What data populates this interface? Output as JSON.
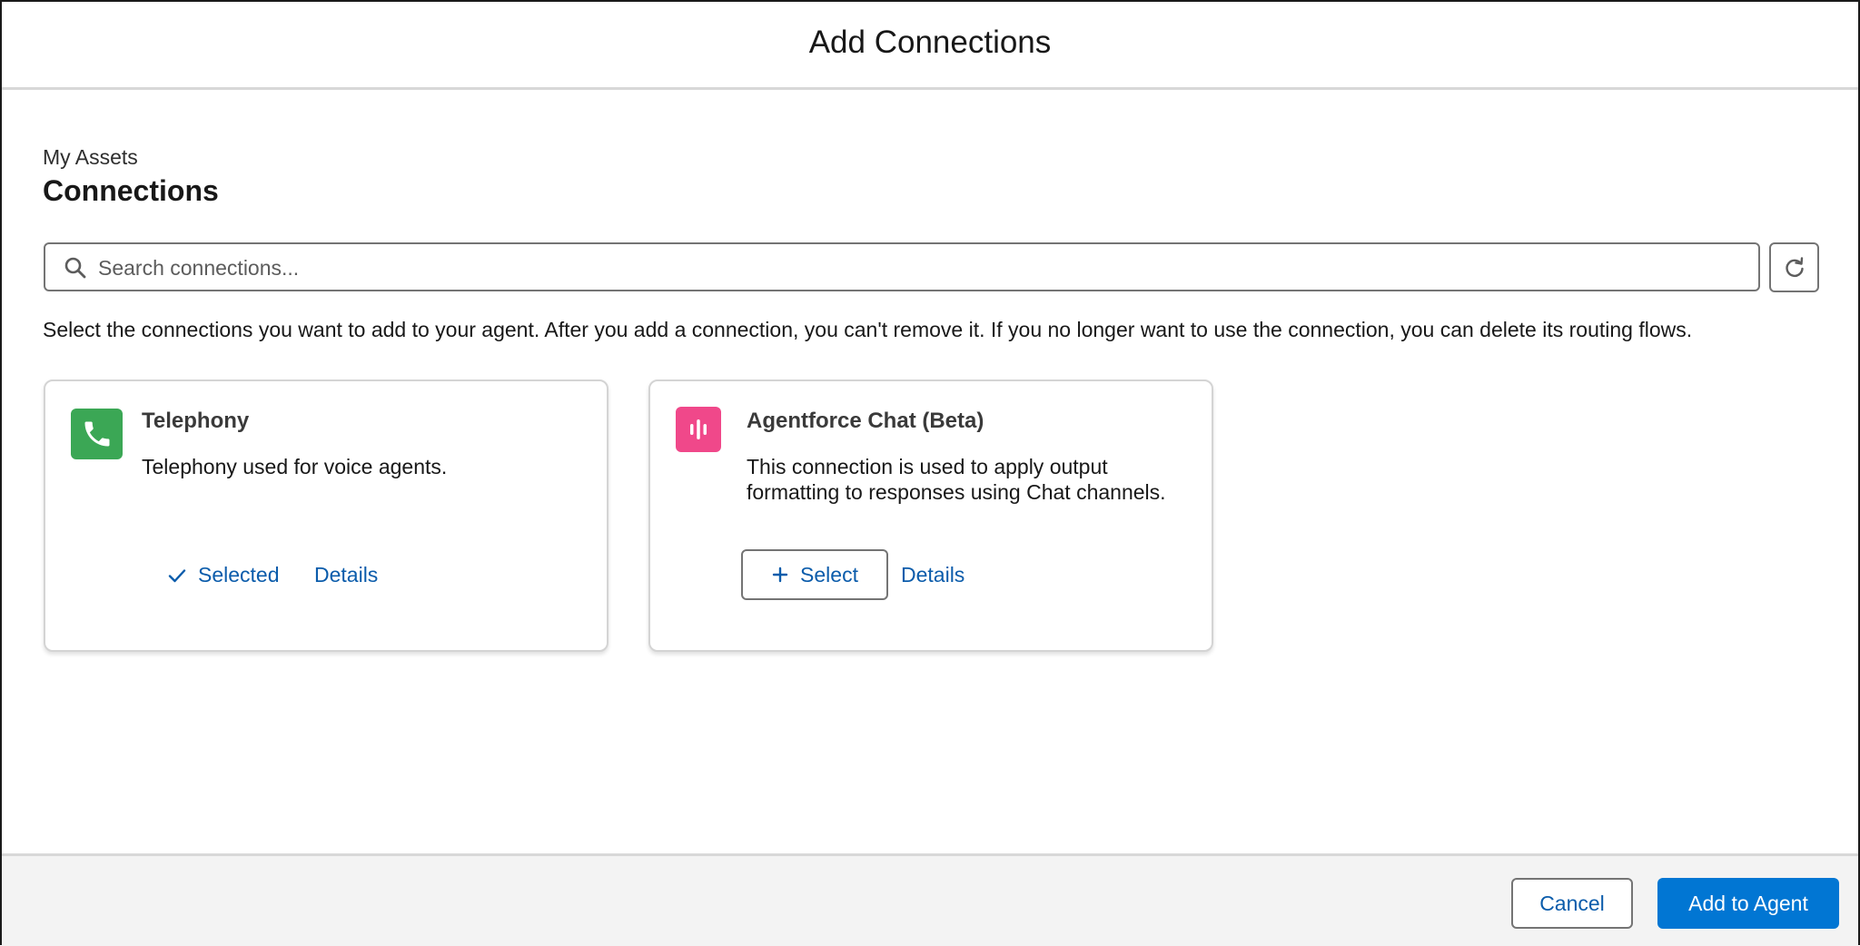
{
  "modal": {
    "title": "Add Connections"
  },
  "section": {
    "eyebrow": "My Assets",
    "title": "Connections"
  },
  "search": {
    "placeholder": "Search connections...",
    "value": ""
  },
  "instructions": "Select the connections you want to add to your agent. After you add a connection, you can't remove it. If you no longer want to use the connection, you can delete its routing flows.",
  "cards": [
    {
      "title": "Telephony",
      "description": "Telephony used for voice agents.",
      "icon": "phone-icon",
      "icon_color": "#3ba755",
      "selected_label": "Selected",
      "details_label": "Details"
    },
    {
      "title": "Agentforce Chat (Beta)",
      "description": "This connection is used to apply output formatting to responses using Chat channels.",
      "icon": "audio-bars-icon",
      "icon_color": "#f0488a",
      "select_label": "Select",
      "details_label": "Details"
    }
  ],
  "footer": {
    "cancel_label": "Cancel",
    "add_label": "Add to Agent"
  },
  "colors": {
    "link": "#0b5cab",
    "brand_button": "#0176d3"
  }
}
